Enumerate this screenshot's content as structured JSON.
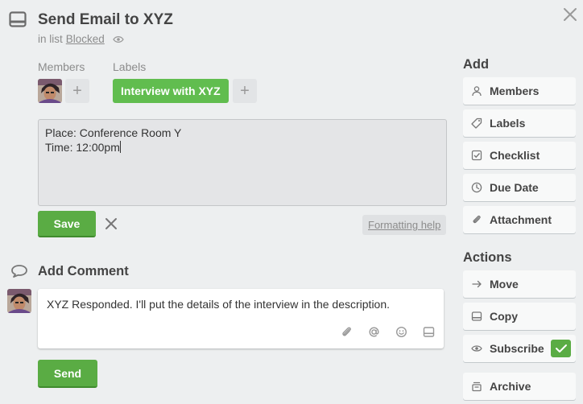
{
  "card": {
    "title": "Send Email to XYZ",
    "in_list_prefix": "in list",
    "list_name": "Blocked"
  },
  "members": {
    "label": "Members",
    "add_symbol": "+"
  },
  "labels": {
    "label": "Labels",
    "items": [
      {
        "text": "Interview with XYZ",
        "color": "#61bd4f"
      }
    ],
    "add_symbol": "+"
  },
  "description": {
    "lines": [
      "Place: Conference Room Y",
      "Time: 12:00pm"
    ],
    "save_label": "Save",
    "formatting_help": "Formatting help"
  },
  "comment": {
    "heading": "Add Comment",
    "text": "XYZ Responded. I'll put the details of the interview in the description.",
    "send_label": "Send"
  },
  "sidebar": {
    "add_heading": "Add",
    "add_items": [
      {
        "label": "Members",
        "icon": "person-icon"
      },
      {
        "label": "Labels",
        "icon": "tag-icon"
      },
      {
        "label": "Checklist",
        "icon": "checkbox-icon"
      },
      {
        "label": "Due Date",
        "icon": "clock-icon"
      },
      {
        "label": "Attachment",
        "icon": "paperclip-icon"
      }
    ],
    "actions_heading": "Actions",
    "action_items": [
      {
        "label": "Move",
        "icon": "arrow-right-icon"
      },
      {
        "label": "Copy",
        "icon": "card-icon"
      },
      {
        "label": "Subscribe",
        "icon": "eye-icon",
        "checked": true
      },
      {
        "label": "Archive",
        "icon": "archive-icon"
      }
    ]
  },
  "colors": {
    "green": "#5aac44",
    "label_green": "#61bd4f",
    "background": "#edeff0"
  }
}
